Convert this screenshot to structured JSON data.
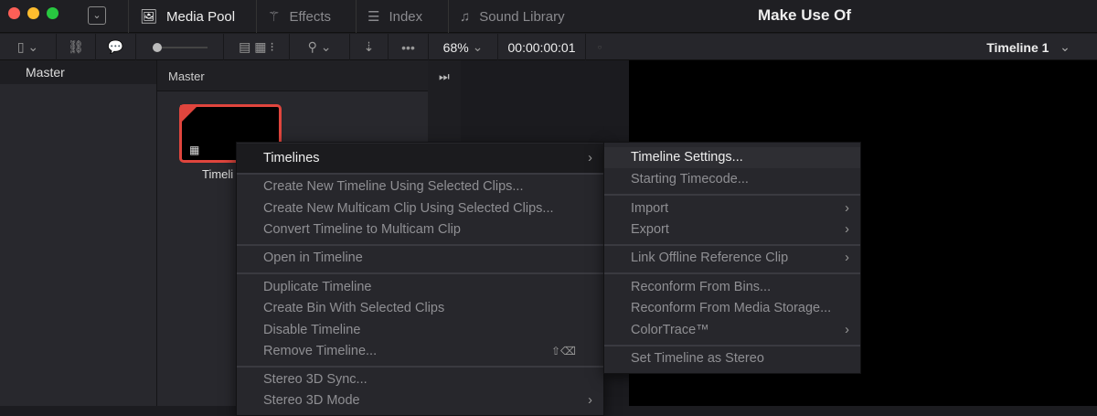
{
  "window": {
    "title": "Make Use Of"
  },
  "tabs": [
    {
      "label": "Media Pool",
      "icon": "media-pool-icon"
    },
    {
      "label": "Effects",
      "icon": "effects-wand-icon"
    },
    {
      "label": "Index",
      "icon": "index-list-icon"
    },
    {
      "label": "Sound Library",
      "icon": "sound-library-icon"
    }
  ],
  "toolbar": {
    "zoom": "68%",
    "timecode": "00:00:00:01",
    "timeline_name": "Timeline 1"
  },
  "sidebar": {
    "header": "Master"
  },
  "bin": {
    "header": "Master",
    "clip_label": "Timeli"
  },
  "context_menu": {
    "items": [
      {
        "label": "Timelines",
        "submenu": true
      },
      {
        "label": "Create New Timeline Using Selected Clips..."
      },
      {
        "label": "Create New Multicam Clip Using Selected Clips..."
      },
      {
        "label": "Convert Timeline to Multicam Clip"
      },
      {
        "label": "Open in Timeline"
      },
      {
        "label": "Duplicate Timeline"
      },
      {
        "label": "Create Bin With Selected Clips"
      },
      {
        "label": "Disable Timeline"
      },
      {
        "label": "Remove Timeline...",
        "shortcut": "⇧⌫"
      },
      {
        "label": "Stereo 3D Sync..."
      },
      {
        "label": "Stereo 3D Mode",
        "submenu": true
      }
    ]
  },
  "submenu": {
    "items": [
      {
        "label": "Timeline Settings..."
      },
      {
        "label": "Starting Timecode..."
      },
      {
        "label": "Import",
        "submenu": true
      },
      {
        "label": "Export",
        "submenu": true
      },
      {
        "label": "Link Offline Reference Clip",
        "submenu": true
      },
      {
        "label": "Reconform From Bins..."
      },
      {
        "label": "Reconform From Media Storage..."
      },
      {
        "label": "ColorTrace™",
        "submenu": true
      },
      {
        "label": "Set Timeline as Stereo"
      }
    ]
  }
}
